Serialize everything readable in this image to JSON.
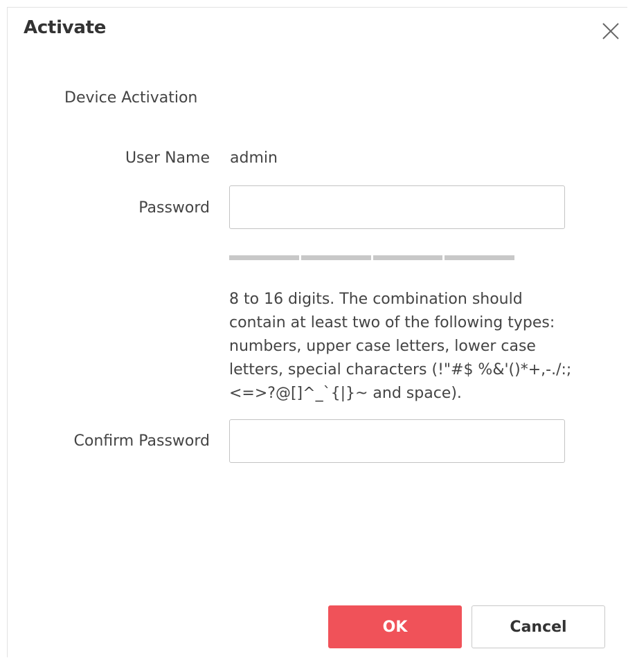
{
  "dialog": {
    "title": "Activate",
    "close_icon": "close-icon"
  },
  "form": {
    "section_title": "Device Activation",
    "user_name_label": "User Name",
    "user_name_value": "admin",
    "password_label": "Password",
    "password_value": "",
    "strength_segments": 4,
    "password_hint": "8 to 16 digits. The combination should contain at least two of the following types: numbers, upper case letters, lower case letters, special characters (!\"#$ %&'()*+,-./:;<=>?@[]^_`{|}~ and space).",
    "confirm_password_label": "Confirm Password",
    "confirm_password_value": ""
  },
  "buttons": {
    "ok_label": "OK",
    "cancel_label": "Cancel"
  },
  "colors": {
    "primary": "#f05259",
    "strength_bar": "#c8c8c8",
    "text": "#444444"
  }
}
